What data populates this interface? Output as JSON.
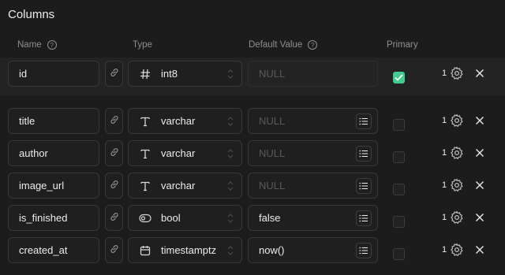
{
  "section_title": "Columns",
  "headers": {
    "name": "Name",
    "type": "Type",
    "default": "Default Value",
    "primary": "Primary",
    "help": "?"
  },
  "rows": [
    {
      "name": "id",
      "type": "int8",
      "type_icon": "hash-icon",
      "default": "NULL",
      "default_placeholder": true,
      "primary": true,
      "badge": "1"
    },
    {
      "name": "title",
      "type": "varchar",
      "type_icon": "text-type-icon",
      "default": "NULL",
      "default_placeholder": true,
      "primary": false,
      "badge": "1"
    },
    {
      "name": "author",
      "type": "varchar",
      "type_icon": "text-type-icon",
      "default": "NULL",
      "default_placeholder": true,
      "primary": false,
      "badge": "1"
    },
    {
      "name": "image_url",
      "type": "varchar",
      "type_icon": "text-type-icon",
      "default": "NULL",
      "default_placeholder": true,
      "primary": false,
      "badge": "1"
    },
    {
      "name": "is_finished",
      "type": "bool",
      "type_icon": "toggle-icon",
      "default": "false",
      "default_placeholder": false,
      "primary": false,
      "badge": "1"
    },
    {
      "name": "created_at",
      "type": "timestamptz",
      "type_icon": "calendar-icon",
      "default": "now()",
      "default_placeholder": false,
      "primary": false,
      "badge": "1"
    }
  ],
  "colors": {
    "accent": "#3ecf8e",
    "background": "#1c1c1c",
    "border": "#383838"
  }
}
